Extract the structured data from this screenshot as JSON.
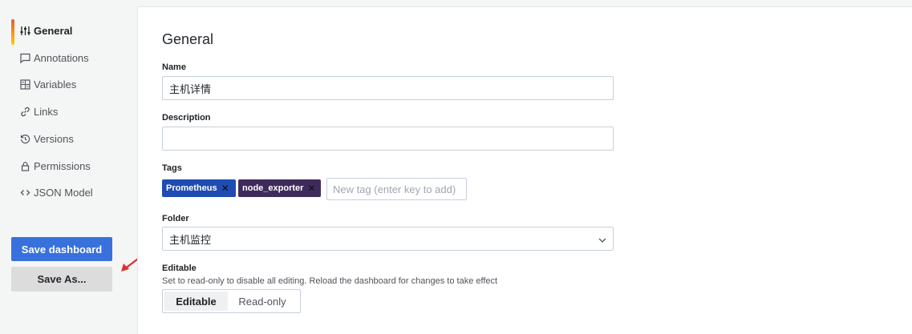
{
  "sidebar": {
    "items": [
      {
        "label": "General",
        "icon": "sliders-icon"
      },
      {
        "label": "Annotations",
        "icon": "comment-icon"
      },
      {
        "label": "Variables",
        "icon": "calculator-icon"
      },
      {
        "label": "Links",
        "icon": "link-icon"
      },
      {
        "label": "Versions",
        "icon": "history-icon"
      },
      {
        "label": "Permissions",
        "icon": "lock-icon"
      },
      {
        "label": "JSON Model",
        "icon": "code-icon"
      }
    ],
    "save_label": "Save dashboard",
    "save_as_label": "Save As..."
  },
  "main": {
    "title": "General",
    "name_label": "Name",
    "name_value": "主机详情",
    "description_label": "Description",
    "description_value": "",
    "tags_label": "Tags",
    "tags": [
      {
        "label": "Prometheus",
        "color": "#1f4cb2"
      },
      {
        "label": "node_exporter",
        "color": "#3f2b5b"
      }
    ],
    "tag_placeholder": "New tag (enter key to add)",
    "folder_label": "Folder",
    "folder_value": "主机监控",
    "editable_label": "Editable",
    "editable_hint": "Set to read-only to disable all editing. Reload the dashboard for changes to take effect",
    "editable_options": [
      "Editable",
      "Read-only"
    ],
    "editable_selected": "Editable"
  },
  "colors": {
    "primary": "#3871dc",
    "annotation_arrow": "#e02f2f",
    "active_indicator": "#f05a28"
  }
}
